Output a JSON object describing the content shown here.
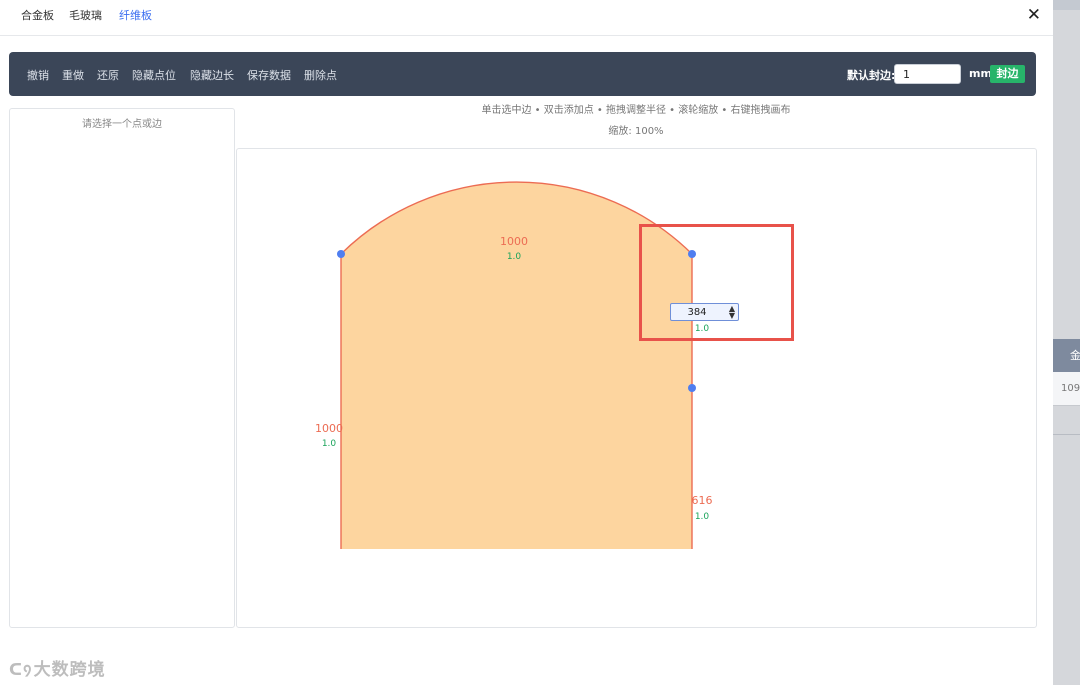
{
  "tabs": [
    {
      "label": "合金板",
      "active": false
    },
    {
      "label": "毛玻璃",
      "active": false
    },
    {
      "label": "纤维板",
      "active": true
    }
  ],
  "close_icon": "close-icon",
  "toolbar": {
    "items": [
      "撤销",
      "重做",
      "还原",
      "隐藏点位",
      "隐藏边长",
      "保存数据",
      "删除点"
    ],
    "default_seal_label": "默认封边:",
    "default_seal_value": "1",
    "unit": "mm",
    "seal_button": "封边"
  },
  "side_panel": {
    "hint": "请选择一个点或边"
  },
  "canvas": {
    "help_text": "单击选中边 • 双击添加点 • 拖拽调整半径 • 滚轮缩放 • 右键拖拽画布",
    "zoom": "缩放: 100%",
    "shape_fill": "#fdd59f",
    "shape_stroke": "#ec6c53",
    "point_color": "#4f7ef0",
    "length_color": "#ec6c53",
    "seal_color": "#1aa35a",
    "edges": [
      {
        "length": "1000",
        "seal": "1.0",
        "name": "arc-edge"
      },
      {
        "length": "1000",
        "seal": "1.0",
        "name": "left-edge"
      },
      {
        "length": "616",
        "seal": "1.0",
        "name": "right-edge"
      }
    ],
    "radius_value": "384",
    "radius_seal": "1.0"
  },
  "backdrop": {
    "header_fragment": "金",
    "cell_fragment": "109"
  },
  "watermark": "大数跨境"
}
